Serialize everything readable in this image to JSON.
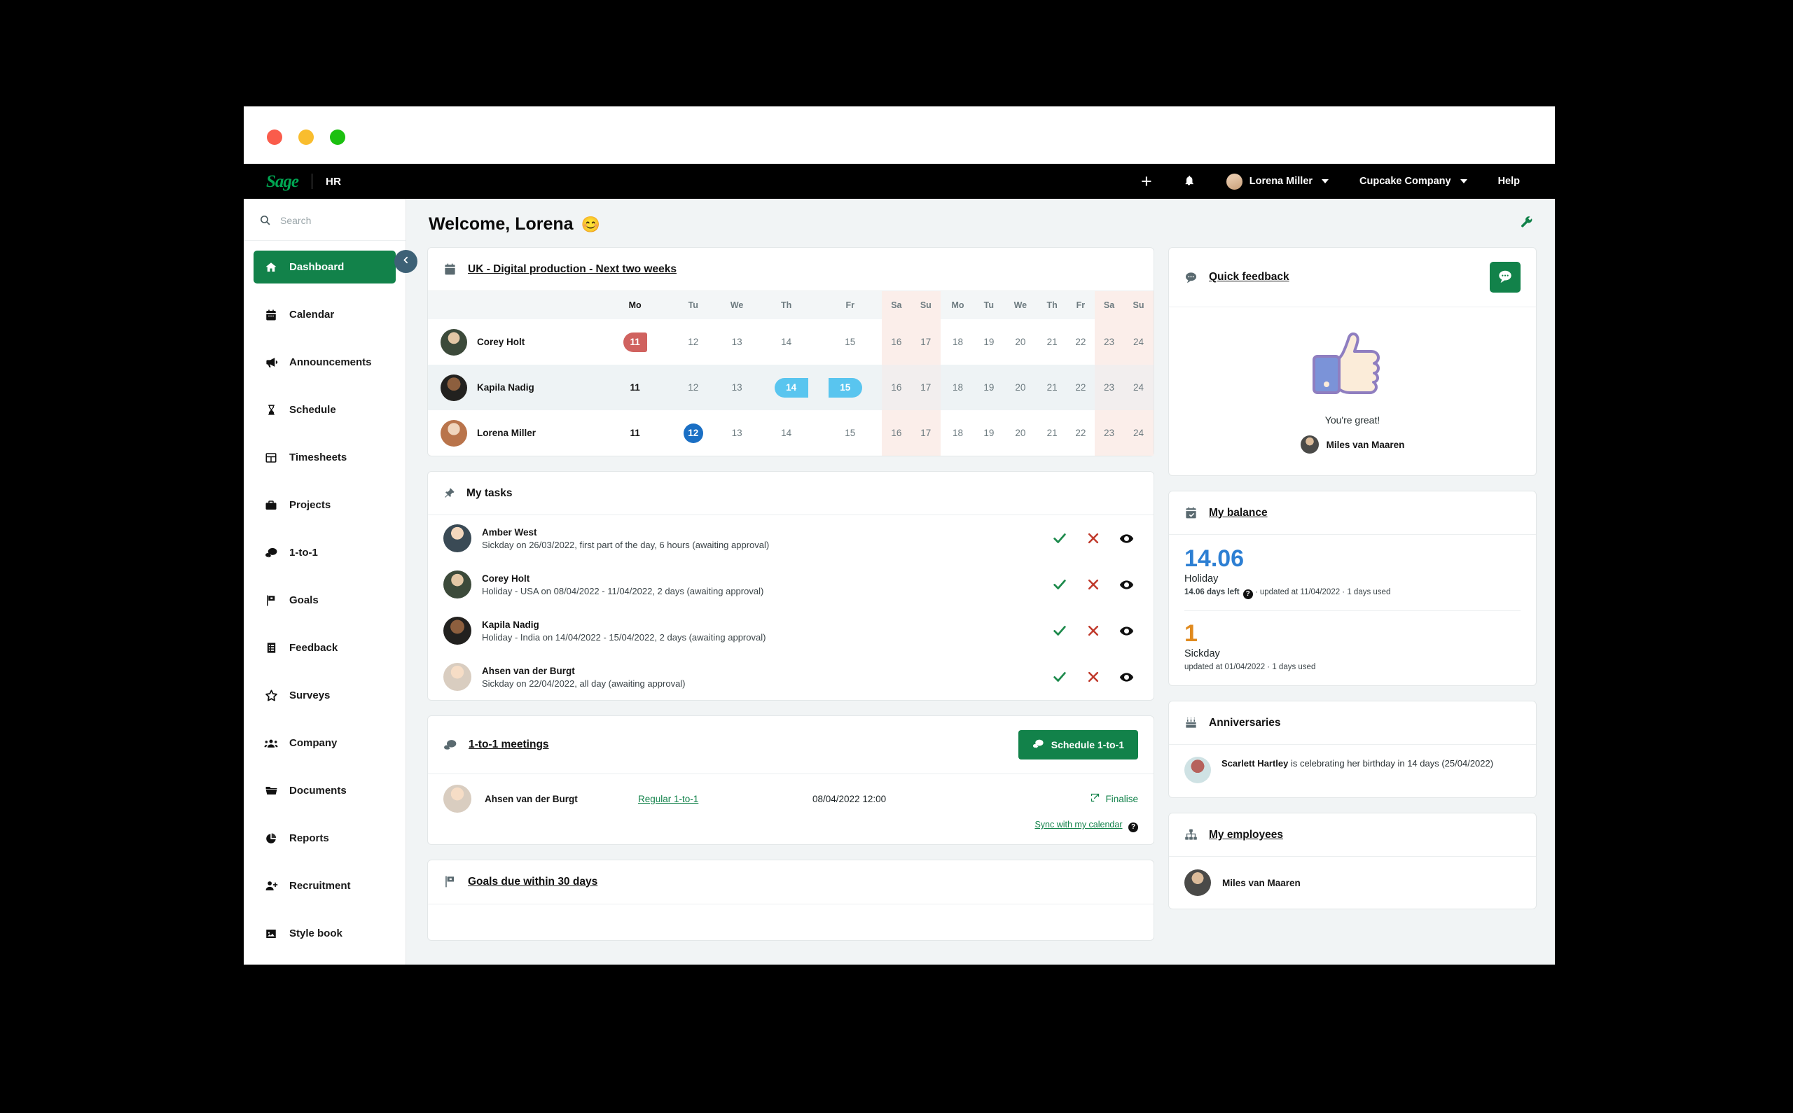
{
  "topnav": {
    "logo": "Sage",
    "product": "HR",
    "add_label": "+",
    "notifications_icon": "bell-icon",
    "user_name": "Lorena Miller",
    "company_name": "Cupcake Company",
    "help_label": "Help"
  },
  "sidebar": {
    "search_placeholder": "Search",
    "items": [
      {
        "label": "Dashboard",
        "icon": "home-icon",
        "active": true
      },
      {
        "label": "Calendar",
        "icon": "calendar-icon",
        "active": false
      },
      {
        "label": "Announcements",
        "icon": "megaphone-icon",
        "active": false
      },
      {
        "label": "Schedule",
        "icon": "hourglass-icon",
        "active": false
      },
      {
        "label": "Timesheets",
        "icon": "table-icon",
        "active": false
      },
      {
        "label": "Projects",
        "icon": "briefcase-icon",
        "active": false
      },
      {
        "label": "1-to-1",
        "icon": "chat-bubbles-icon",
        "active": false
      },
      {
        "label": "Goals",
        "icon": "finish-flag-icon",
        "active": false
      },
      {
        "label": "Feedback",
        "icon": "list-form-icon",
        "active": false
      },
      {
        "label": "Surveys",
        "icon": "star-icon",
        "active": false
      },
      {
        "label": "Company",
        "icon": "people-group-icon",
        "active": false
      },
      {
        "label": "Documents",
        "icon": "folder-icon",
        "active": false
      },
      {
        "label": "Reports",
        "icon": "pie-chart-icon",
        "active": false
      },
      {
        "label": "Recruitment",
        "icon": "person-plus-icon",
        "active": false
      },
      {
        "label": "Style book",
        "icon": "image-icon",
        "active": false
      }
    ]
  },
  "page": {
    "title": "Welcome, Lorena",
    "title_emoji": "😊",
    "settings_icon": "wrench-icon"
  },
  "calendar_card": {
    "icon": "calendar-icon",
    "title": "UK - Digital production - Next two weeks",
    "day_headers": [
      "Mo",
      "Tu",
      "We",
      "Th",
      "Fr",
      "Sa",
      "Su",
      "Mo",
      "Tu",
      "We",
      "Th",
      "Fr",
      "Sa",
      "Su"
    ],
    "weekend_indexes": [
      5,
      6,
      12,
      13
    ],
    "rows": [
      {
        "name": "Corey Holt",
        "avatar": "av-corey",
        "days": [
          {
            "n": "11",
            "style": "pill-red"
          },
          {
            "n": "12",
            "style": ""
          },
          {
            "n": "13",
            "style": ""
          },
          {
            "n": "14",
            "style": ""
          },
          {
            "n": "15",
            "style": ""
          },
          {
            "n": "16",
            "style": ""
          },
          {
            "n": "17",
            "style": ""
          },
          {
            "n": "18",
            "style": ""
          },
          {
            "n": "19",
            "style": ""
          },
          {
            "n": "20",
            "style": ""
          },
          {
            "n": "21",
            "style": ""
          },
          {
            "n": "22",
            "style": ""
          },
          {
            "n": "23",
            "style": ""
          },
          {
            "n": "24",
            "style": ""
          }
        ]
      },
      {
        "name": "Kapila Nadig",
        "avatar": "av-kapila",
        "days": [
          {
            "n": "11",
            "style": "strong"
          },
          {
            "n": "12",
            "style": ""
          },
          {
            "n": "13",
            "style": ""
          },
          {
            "n": "14",
            "style": "pill-cyan-l"
          },
          {
            "n": "15",
            "style": "pill-cyan-r"
          },
          {
            "n": "16",
            "style": ""
          },
          {
            "n": "17",
            "style": ""
          },
          {
            "n": "18",
            "style": ""
          },
          {
            "n": "19",
            "style": ""
          },
          {
            "n": "20",
            "style": ""
          },
          {
            "n": "21",
            "style": ""
          },
          {
            "n": "22",
            "style": ""
          },
          {
            "n": "23",
            "style": ""
          },
          {
            "n": "24",
            "style": ""
          }
        ]
      },
      {
        "name": "Lorena Miller",
        "avatar": "av-lorena",
        "days": [
          {
            "n": "11",
            "style": "strong"
          },
          {
            "n": "12",
            "style": "pill-blue"
          },
          {
            "n": "13",
            "style": ""
          },
          {
            "n": "14",
            "style": ""
          },
          {
            "n": "15",
            "style": ""
          },
          {
            "n": "16",
            "style": ""
          },
          {
            "n": "17",
            "style": ""
          },
          {
            "n": "18",
            "style": ""
          },
          {
            "n": "19",
            "style": ""
          },
          {
            "n": "20",
            "style": ""
          },
          {
            "n": "21",
            "style": ""
          },
          {
            "n": "22",
            "style": ""
          },
          {
            "n": "23",
            "style": ""
          },
          {
            "n": "24",
            "style": ""
          }
        ]
      }
    ]
  },
  "tasks_card": {
    "icon": "pin-icon",
    "title": "My tasks",
    "approve_icon": "check-icon",
    "decline_icon": "cross-icon",
    "view_icon": "eye-icon",
    "items": [
      {
        "name": "Amber West",
        "avatar": "av-amber",
        "desc": "Sickday on 26/03/2022, first part of the day, 6 hours (awaiting approval)"
      },
      {
        "name": "Corey Holt",
        "avatar": "av-corey",
        "desc": "Holiday - USA on 08/04/2022 - 11/04/2022, 2 days (awaiting approval)"
      },
      {
        "name": "Kapila Nadig",
        "avatar": "av-kapila",
        "desc": "Holiday - India on 14/04/2022 - 15/04/2022, 2 days (awaiting approval)"
      },
      {
        "name": "Ahsen van der Burgt",
        "avatar": "av-ahsen",
        "desc": "Sickday on 22/04/2022, all day (awaiting approval)"
      }
    ]
  },
  "meetings_card": {
    "icon": "chat-bubbles-icon",
    "title": "1-to-1 meetings",
    "schedule_button": "Schedule 1-to-1",
    "schedule_icon": "chat-bubbles-icon",
    "row": {
      "name": "Ahsen van der Burgt",
      "avatar": "av-ahsen",
      "type": "Regular 1-to-1",
      "datetime": "08/04/2022 12:00",
      "finalise_label": "Finalise",
      "finalise_icon": "edit-square-icon"
    },
    "sync_label": "Sync with my calendar",
    "sync_help_icon": "question-mark-icon"
  },
  "goals_card": {
    "icon": "finish-flag-icon",
    "title": "Goals due within 30 days"
  },
  "quick_feedback": {
    "icon": "chat-bubble-icon",
    "title": "Quick feedback",
    "action_icon": "chat-bubble-icon",
    "message": "You're great!",
    "author": "Miles van Maaren",
    "author_avatar": "av-miles",
    "illustration": "thumbs-up-illustration"
  },
  "my_balance": {
    "icon": "calendar-check-icon",
    "title": "My balance",
    "entries": [
      {
        "value": "14.06",
        "color": "#2d7fd3",
        "label": "Holiday",
        "meta_bold": "14.06 days left",
        "meta_rest": " · updated at 11/04/2022 · 1 days used",
        "has_help": true
      },
      {
        "value": "1",
        "color": "#e08a1e",
        "label": "Sickday",
        "meta_bold": "",
        "meta_rest": "updated at 01/04/2022 · 1 days used",
        "has_help": false
      }
    ]
  },
  "anniversaries": {
    "icon": "cake-icon",
    "title": "Anniversaries",
    "person": "Scarlett Hartley",
    "avatar": "av-scarlett",
    "text": " is celebrating her birthday in 14 days (25/04/2022)"
  },
  "my_employees": {
    "icon": "org-chart-icon",
    "title": "My employees",
    "items": [
      {
        "name": "Miles van Maaren",
        "avatar": "av-miles"
      }
    ]
  },
  "window": {
    "close_dot": "close-window-dot",
    "minimize_dot": "minimize-window-dot",
    "maximize_dot": "maximize-window-dot"
  },
  "colors": {
    "brand_green": "#12824a",
    "logo_green": "#00a652",
    "accent_blue": "#2d7fd3",
    "accent_orange": "#e08a1e",
    "pill_red": "#d0625f",
    "pill_cyan": "#59c5ef",
    "pill_blue": "#1a6fc4"
  }
}
